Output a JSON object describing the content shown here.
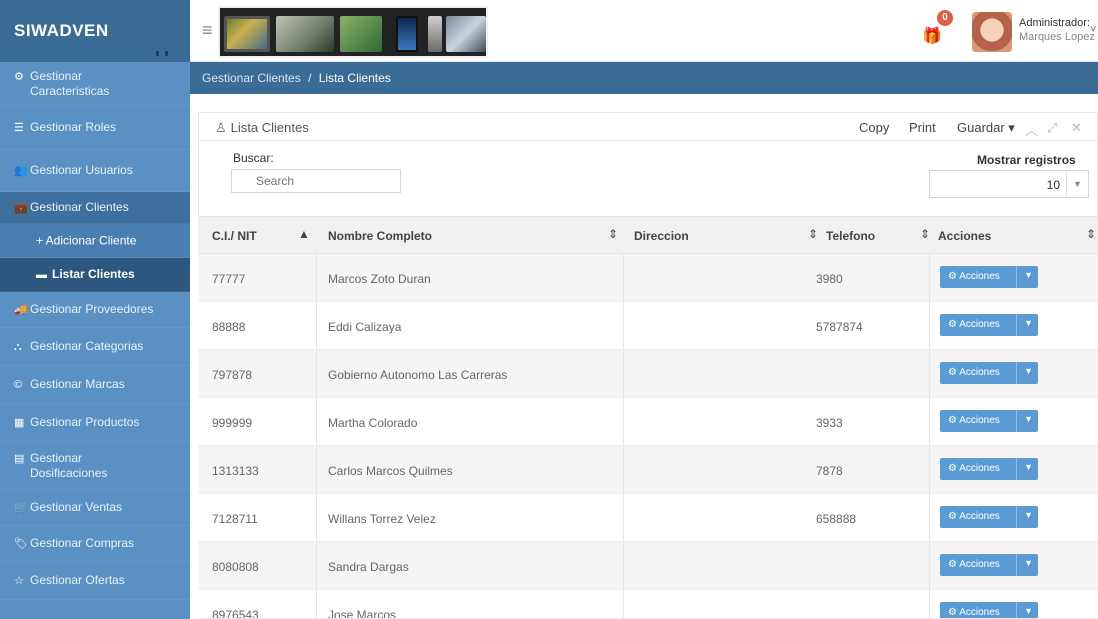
{
  "brand": "SIWADVEN",
  "header": {
    "notification_count": "0",
    "admin_title": "Administrador:",
    "admin_name": "Marques Lopez"
  },
  "sidebar": {
    "items": [
      {
        "label": "Gestionar Caracteristicas",
        "icon": "gears-icon"
      },
      {
        "label": "Gestionar Roles",
        "icon": "list-icon"
      },
      {
        "label": "Gestionar Usuarios",
        "icon": "users-icon"
      },
      {
        "label": "Gestionar Clientes",
        "icon": "briefcase-icon"
      },
      {
        "label": "+ Adicionar Cliente",
        "icon": "plus-icon"
      },
      {
        "label": "Listar Clientes",
        "icon": "table-icon"
      },
      {
        "label": "Gestionar Proveedores",
        "icon": "truck-icon"
      },
      {
        "label": "Gestionar Categorias",
        "icon": "sitemap-icon"
      },
      {
        "label": "Gestionar Marcas",
        "icon": "copyright-icon"
      },
      {
        "label": "Gestionar Productos",
        "icon": "barcode-icon"
      },
      {
        "label": "Gestionar Dosificaciones",
        "icon": "file-icon"
      },
      {
        "label": "Gestionar Ventas",
        "icon": "cart-icon"
      },
      {
        "label": "Gestionar Compras",
        "icon": "tag-icon"
      },
      {
        "label": "Gestionar Ofertas",
        "icon": "star-icon"
      }
    ]
  },
  "breadcrumb": {
    "parent": "Gestionar Clientes",
    "separator": "/",
    "current": "Lista Clientes"
  },
  "panel": {
    "title": "Lista Clientes",
    "copy": "Copy",
    "print": "Print",
    "guardar": "Guardar ▾",
    "search_label": "Buscar:",
    "search_placeholder": "Search",
    "show_label": "Mostrar registros",
    "show_value": "10"
  },
  "table": {
    "headers": [
      "C.I./ NIT",
      "Nombre Completo",
      "Direccion",
      "Telefono",
      "Acciones"
    ],
    "action_label": "Acciones",
    "rows": [
      {
        "ci": "77777",
        "nombre": "Marcos Zoto Duran",
        "direccion": "",
        "telefono": "3980"
      },
      {
        "ci": "88888",
        "nombre": "Eddi Calizaya",
        "direccion": "",
        "telefono": "5787874"
      },
      {
        "ci": "797878",
        "nombre": "Gobierno Autonomo Las Carreras",
        "direccion": "",
        "telefono": ""
      },
      {
        "ci": "999999",
        "nombre": "Martha Colorado",
        "direccion": "",
        "telefono": "3933"
      },
      {
        "ci": "1313133",
        "nombre": "Carlos Marcos Quilmes",
        "direccion": "",
        "telefono": "7878"
      },
      {
        "ci": "7128711",
        "nombre": "Willans Torrez Velez",
        "direccion": "",
        "telefono": "658888"
      },
      {
        "ci": "8080808",
        "nombre": "Sandra Dargas",
        "direccion": "",
        "telefono": ""
      },
      {
        "ci": "8976543",
        "nombre": "Jose Marcos",
        "direccion": "",
        "telefono": ""
      }
    ]
  },
  "colors": {
    "sidebar": "#5a90c2",
    "header_blue": "#3b6c95",
    "action_button": "#5b9bd5"
  }
}
